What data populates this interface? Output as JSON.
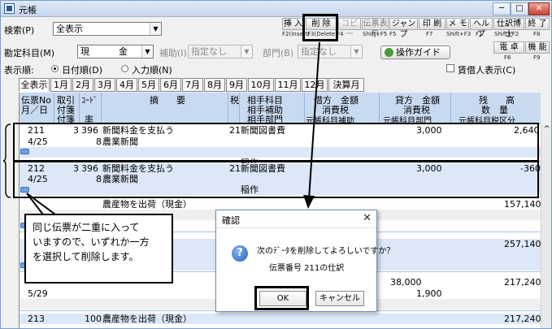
{
  "window": {
    "title": "元帳"
  },
  "toolbar": {
    "search_label": "検索(P)",
    "search_value": "全表示",
    "buttons": [
      {
        "label": "挿 入",
        "key": "F2(Insert)"
      },
      {
        "label": "削 除",
        "key": "F3(Delete)"
      },
      {
        "label": "コピー",
        "key": "F4"
      },
      {
        "label": "伝票表示",
        "key": "Shift+F5"
      },
      {
        "label": "ジャンプ",
        "key": "F5"
      },
      {
        "label": "印 刷",
        "key": "F7"
      },
      {
        "label": "メ モ",
        "key": "Shift+F3"
      },
      {
        "label": "ヘルプ",
        "key": "F1"
      },
      {
        "label": "仕訳博士",
        "key": "Shift+F2"
      },
      {
        "label": "終 了",
        "key": "F8"
      },
      {
        "label": "電 卓",
        "key": "F6"
      },
      {
        "label": "機 能",
        "key": "F9"
      }
    ],
    "account_label": "勘定科目(M)",
    "account_value1": "現",
    "account_value2": "金",
    "sub_label": "補助(I)",
    "sub_value": "指定なし",
    "dept_label": "部門(B)",
    "dept_value": "指定なし",
    "guide_label": "操作ガイド",
    "order_label": "表示順:",
    "order_date": "日付順(D)",
    "order_input": "入力順(N)",
    "tenant_label": "賃借人表示(C)"
  },
  "tabs": [
    "全表示",
    "1月",
    "2月",
    "3月",
    "4月",
    "5月",
    "6月",
    "7月",
    "8月",
    "9月",
    "10月",
    "11月",
    "12月",
    "決算月"
  ],
  "headers": {
    "c1": [
      "伝票No",
      "月／日"
    ],
    "c2": [
      "取引",
      "付箋",
      "付箋"
    ],
    "c3": [
      "ｺｰﾄﾞ",
      "率"
    ],
    "c4": "摘　　要",
    "c5": "税",
    "c6": [
      "相手科目",
      "相手補助",
      "相手部門"
    ],
    "c7": [
      "借方　金額",
      "消費税",
      "元帳科目補助"
    ],
    "c8": [
      "貸方　金額",
      "消費税",
      "元帳科目部門"
    ],
    "c9": [
      "残　　高",
      "数　量",
      "元帳科目税区分"
    ]
  },
  "rows": [
    {
      "no": "211",
      "tr": "3",
      "code": "396",
      "desc": "新聞料金を支払う",
      "tax": "21",
      "acct": "新聞図書費",
      "credit": "3,000",
      "balance": "2,640",
      "date": "4/25",
      "rate": "8",
      "desc2": "農業新聞",
      "sub": "稲作"
    },
    {
      "no": "212",
      "tr": "3",
      "code": "396",
      "desc": "新聞料金を支払う",
      "tax": "21",
      "acct": "新聞図書費",
      "credit": "3,000",
      "balance": "-360",
      "date": "4/25",
      "rate": "8",
      "desc2": "農業新聞",
      "sub": "稲作"
    },
    {
      "desc": "農産物を出荷（現金）",
      "balance": "157,140"
    },
    {
      "balance": "257,140"
    },
    {
      "debit": "38,000",
      "balance": "217,240"
    },
    {
      "date": "5/29",
      "credit": "1,900"
    },
    {
      "no": "213",
      "code": "100",
      "desc": "農産物を出荷（現金）",
      "balance": "217,240"
    }
  ],
  "callout": [
    "同じ伝票が二重に入って",
    "いますので、いずれか一方",
    "を選択して削除します。"
  ],
  "dialog": {
    "title": "確認",
    "message": "次のﾃﾞｰﾀを削除してよろしいですか？",
    "detail": "伝票番号 211の仕訳",
    "ok": "OK",
    "cancel": "キャンセル"
  }
}
